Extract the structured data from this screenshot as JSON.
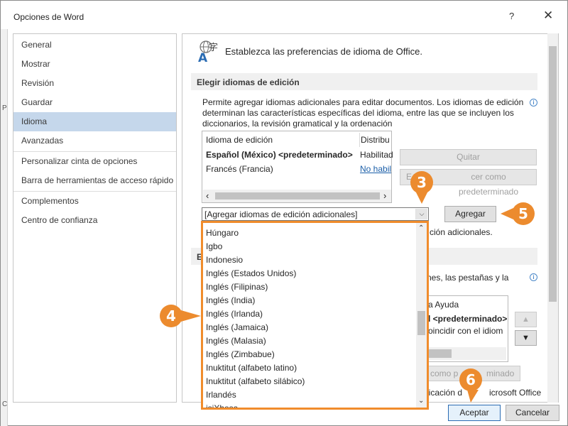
{
  "dialog": {
    "title": "Opciones de Word",
    "help_glyph": "?",
    "close_glyph": "✕"
  },
  "background": {
    "fragment_p": "P",
    "fragment_c": "C"
  },
  "sidebar": {
    "items": [
      {
        "label": "General"
      },
      {
        "label": "Mostrar"
      },
      {
        "label": "Revisión"
      },
      {
        "label": "Guardar"
      },
      {
        "label": "Idioma",
        "active": true
      },
      {
        "label": "Avanzadas"
      },
      {
        "label": "Personalizar cinta de opciones"
      },
      {
        "label": "Barra de herramientas de acceso rápido"
      },
      {
        "label": "Complementos"
      },
      {
        "label": "Centro de confianza"
      }
    ]
  },
  "content": {
    "header_icon": "language-icon",
    "header_text": "Establezca las preferencias de idioma de Office.",
    "section_edit_title": "Elegir idiomas de edición",
    "edit_description": "Permite agregar idiomas adicionales para editar documentos. Los idiomas de edición determinan las características específicas del idioma, entre las que se incluyen los diccionarios, la revisión gramatical y la ordenación",
    "info_glyph": "i",
    "grid": {
      "headers": [
        "Idioma de edición",
        "Distribu"
      ],
      "rows": [
        {
          "language": "Español (México) <predeterminado>",
          "status": "Habilitad",
          "bold": true
        },
        {
          "language": "Francés (Francia)",
          "status": "No habil",
          "link": true
        }
      ],
      "scroll_left": "‹",
      "scroll_right": "›"
    },
    "buttons": {
      "remove": "Quitar",
      "set_default_left": "E",
      "set_default_right": "cer como predeterminado",
      "add": "Agregar"
    },
    "combo": {
      "value": "[Agregar idiomas de edición adicionales]",
      "arrow": "⌵"
    },
    "dropdown_items": [
      "Húngaro",
      "Igbo",
      "Indonesio",
      "Inglés (Estados Unidos)",
      "Inglés (Filipinas)",
      "Inglés (India)",
      "Inglés (Irlanda)",
      "Inglés (Jamaica)",
      "Inglés (Malasia)",
      "Inglés (Zimbabue)",
      "Inuktitut (alfabeto latino)",
      "Inuktitut (alfabeto silábico)",
      "Irlandés",
      "isiXhosa"
    ],
    "dropdown_scroll_up": "⌃",
    "dropdown_scroll_down": "⌄",
    "fragments": {
      "add_info": "ción adicionales.",
      "section2_letter": "E",
      "display_text": "nes, las pestañas y la",
      "help_item": "a Ayuda",
      "default_item": "l <predeterminado>",
      "match_item": "oincidir con el idiom",
      "set_default2_left": "como p",
      "set_default2_right": "minado",
      "office_text_left": "licación d",
      "office_text_right": "icrosoft Office"
    },
    "arrow_up": "▲",
    "arrow_down": "▼"
  },
  "footer": {
    "ok": "Aceptar",
    "cancel": "Cancelar"
  },
  "callouts": {
    "c3": "3",
    "c4": "4",
    "c5": "5",
    "c6": "6"
  },
  "colors": {
    "accent_orange": "#ec8b2e",
    "selection_blue": "#c5d7eb",
    "link_blue": "#1a5ea8"
  }
}
